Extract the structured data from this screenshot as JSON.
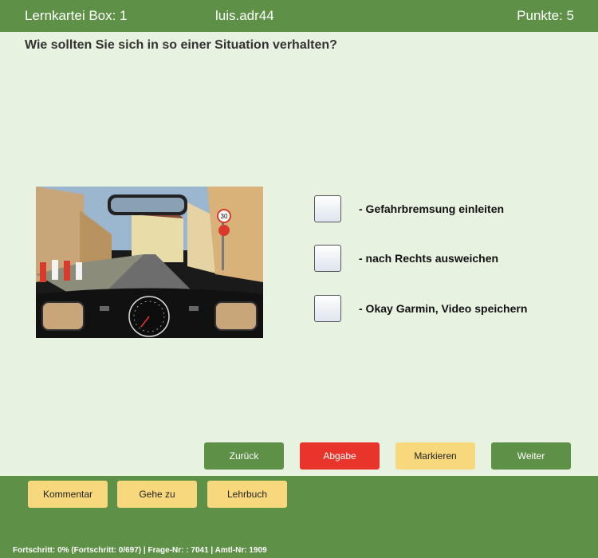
{
  "header": {
    "box_label": "Lernkartei Box: 1",
    "username": "luis.adr44",
    "points_label": "Punkte: 5"
  },
  "question": {
    "text": "Wie sollten Sie sich in so einer Situation verhalten?"
  },
  "image": {
    "sign_speed_limit": "30"
  },
  "answers": [
    {
      "label": "- Gefahrbremsung einleiten",
      "checked": false
    },
    {
      "label": "- nach Rechts ausweichen",
      "checked": false
    },
    {
      "label": "- Okay Garmin, Video speichern",
      "checked": false
    }
  ],
  "nav_buttons": {
    "back": "Zurück",
    "submit": "Abgabe",
    "mark": "Markieren",
    "next": "Weiter"
  },
  "bottom_buttons": {
    "comment": "Kommentar",
    "goto": "Gehe zu",
    "textbook": "Lehrbuch"
  },
  "status": {
    "text": "Fortschritt: 0% (Fortschritt: 0/697) | Frage-Nr: : 7041 | Amtl-Nr: 1909"
  },
  "colors": {
    "bar_green": "#5e9047",
    "background": "#e8f2e1",
    "submit_red": "#e8342a",
    "accent_yellow": "#f7d87c"
  }
}
